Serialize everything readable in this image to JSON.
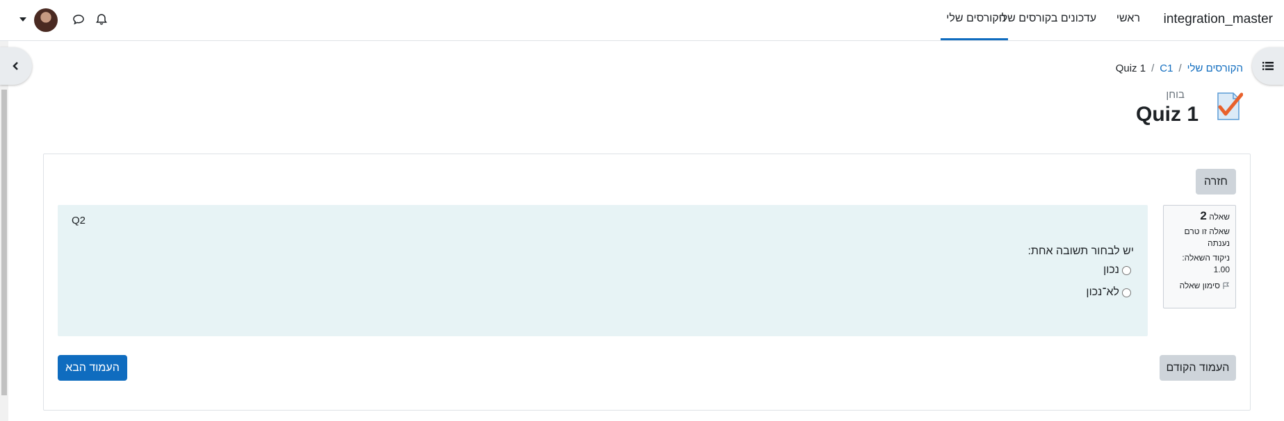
{
  "navbar": {
    "site_name": "integration_master",
    "items": [
      {
        "label": "ראשי"
      },
      {
        "label": "עדכונים בקורסים שלי"
      },
      {
        "label": "הקורסים שלי",
        "active": true
      }
    ],
    "icons": [
      "bell-icon",
      "chat-icon",
      "avatar",
      "caret-down-icon"
    ]
  },
  "breadcrumb": {
    "items": [
      "הקורסים שלי",
      "C1",
      "Quiz 1"
    ],
    "separator": "/"
  },
  "header": {
    "activity_type": "בוחן",
    "title": "Quiz 1"
  },
  "quiz": {
    "back_button": "חזרה",
    "info": {
      "question_label": "שאלה",
      "question_number": "2",
      "status": "שאלה זו טרם נענתה",
      "grade_label": "ניקוד השאלה:",
      "grade_value": "1.00",
      "flag_label": "סימון שאלה"
    },
    "question": {
      "text": "Q2",
      "prompt": "יש לבחור תשובה אחת:",
      "options": [
        "נכון",
        "לא־נכון"
      ]
    },
    "prev_button": "העמוד הקודם",
    "next_button": "העמוד הבא"
  },
  "colors": {
    "primary": "#0f6cbf",
    "secondary_button": "#ced4da",
    "question_bg": "#e7f3f5"
  }
}
